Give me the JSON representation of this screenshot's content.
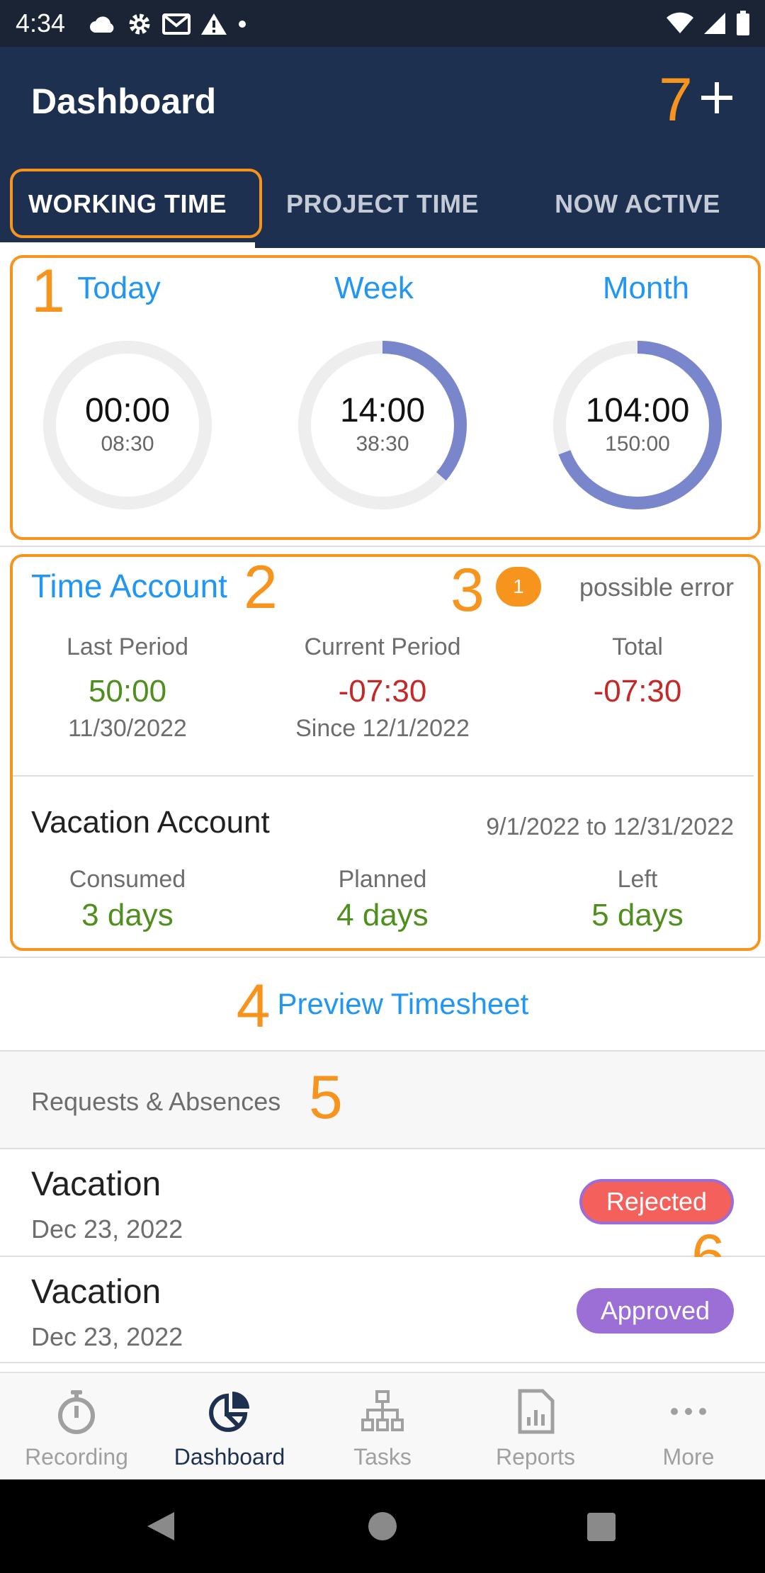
{
  "status": {
    "time": "4:34"
  },
  "appbar": {
    "title": "Dashboard"
  },
  "tabs": [
    {
      "label": "WORKING TIME"
    },
    {
      "label": "PROJECT TIME"
    },
    {
      "label": "NOW ACTIVE"
    }
  ],
  "annotations": [
    "1",
    "2",
    "3",
    "4",
    "5",
    "6",
    "7"
  ],
  "periods": [
    {
      "label": "Today",
      "value": "00:00",
      "target": "08:30",
      "progress": 0.0
    },
    {
      "label": "Week",
      "value": "14:00",
      "target": "38:30",
      "progress": 0.364
    },
    {
      "label": "Month",
      "value": "104:00",
      "target": "150:00",
      "progress": 0.693
    }
  ],
  "time_account": {
    "title": "Time Account",
    "error_count": "1",
    "error_text": "possible error",
    "last_period": {
      "label": "Last Period",
      "value": "50:00",
      "date": "11/30/2022"
    },
    "current_period": {
      "label": "Current Period",
      "value": "-07:30",
      "date": "Since 12/1/2022"
    },
    "total": {
      "label": "Total",
      "value": "-07:30"
    }
  },
  "vacation_account": {
    "title": "Vacation Account",
    "range": "9/1/2022 to 12/31/2022",
    "consumed": {
      "label": "Consumed",
      "value": "3 days"
    },
    "planned": {
      "label": "Planned",
      "value": "4 days"
    },
    "left": {
      "label": "Left",
      "value": "5 days"
    }
  },
  "preview_link": "Preview Timesheet",
  "requests": {
    "header": "Requests & Absences",
    "items": [
      {
        "type": "Vacation",
        "date": "Dec 23, 2022",
        "status": "Rejected"
      },
      {
        "type": "Vacation",
        "date": "Dec 23, 2022",
        "status": "Approved"
      }
    ]
  },
  "bottom_nav": [
    {
      "label": "Recording",
      "icon": "stopwatch-icon"
    },
    {
      "label": "Dashboard",
      "icon": "pie-chart-icon"
    },
    {
      "label": "Tasks",
      "icon": "hierarchy-icon"
    },
    {
      "label": "Reports",
      "icon": "report-document-icon"
    },
    {
      "label": "More",
      "icon": "more-dots-icon"
    }
  ],
  "colors": {
    "appbar": "#1e3050",
    "accent_blue": "#2196f3",
    "annotation_orange": "#f7941d",
    "ring_progress": "#7986cb",
    "positive_green": "#4e8f1e",
    "negative_red": "#c62828",
    "rejected": "#f4605c",
    "approved": "#9c6fd6"
  }
}
